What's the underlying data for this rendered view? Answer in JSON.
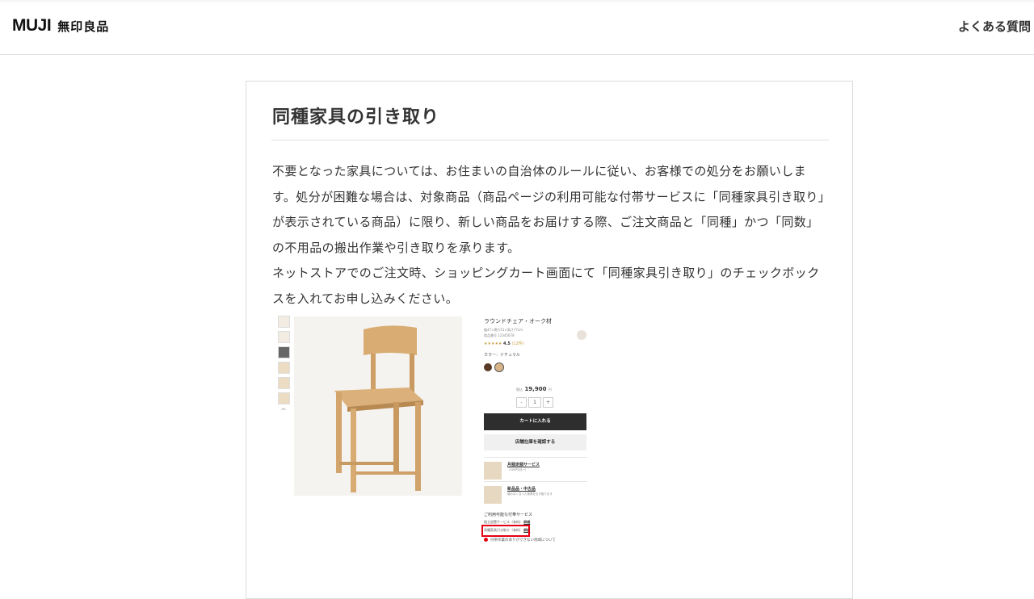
{
  "header": {
    "logo_latin": "MUJI",
    "logo_jp": "無印良品",
    "faq_link": "よくある質問"
  },
  "article": {
    "title": "同種家具の引き取り",
    "paragraphs": [
      "不要となった家具については、お住まいの自治体のルールに従い、お客様での処分をお願いします。処分が困難な場合は、対象商品（商品ページの利用可能な付帯サービスに「同種家具引き取り」が表示されている商品）に限り、新しい商品をお届けする際、ご注文商品と「同種」かつ「同数」の不用品の搬出作業や引き取りを承ります。",
      "ネットストアでのご注文時、ショッピングカート画面にて「同種家具引き取り」のチェックボックスを入れてお申し込みください。"
    ]
  },
  "screenshot": {
    "thumb_arrow": "^",
    "product_name": "ラウンドチェア・オーク材",
    "size_line": "幅47×奥行51×高さ77cm",
    "code_line": "商品番号 12345678",
    "rating_stars": "★★★★★",
    "rating_value": "4.5",
    "rating_count": "(12件)",
    "color_label": "カラー：ナチュラル",
    "price_prefix": "税込",
    "price": "19,900",
    "price_suffix": "円",
    "qty_minus": "-",
    "qty_value": "1",
    "qty_plus": "+",
    "cart_button": "カートに入れる",
    "store_button": "店舗在庫を確認する",
    "service1_title": "月額定額サービス",
    "service1_sub": "（400円/月～）",
    "service2_title": "新品品・中古品",
    "service2_sub": "使わなくなった家具を引き取ります",
    "addon_heading": "ご利用可能な付帯サービス",
    "addon1_label": "組立設置サービス（有料）",
    "addon1_link": "詳細",
    "addon2_label": "同種家具引き取り（有料）",
    "addon2_link": "詳細",
    "notice": "付帯作業の承りができない地域について",
    "colors": {
      "swatch_dark": "#5a3a26",
      "swatch_natural": "#d9b488",
      "highlight": "#e60012"
    }
  }
}
